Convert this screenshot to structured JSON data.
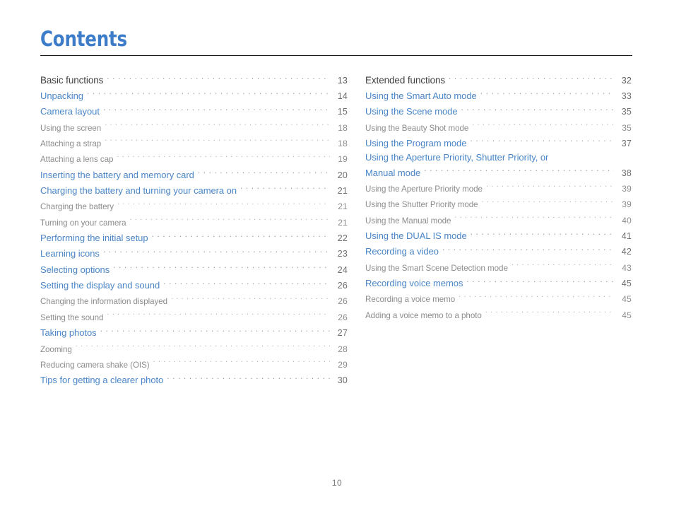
{
  "document": {
    "title": "Contents",
    "folio": "10",
    "accent_color": "#3D7CC9",
    "link_color": "#4A86C8",
    "sub_color": "#8d8d8d",
    "head_color": "#3f3f3f",
    "rule_color": "#1a1a1a"
  },
  "columns": {
    "left": {
      "entries": [
        {
          "label": "Basic functions",
          "page": "13",
          "level": "head"
        },
        {
          "label": "Unpacking",
          "page": "14",
          "level": "link"
        },
        {
          "label": "Camera layout",
          "page": "15",
          "level": "link"
        },
        {
          "label": "Using the screen",
          "page": "18",
          "level": "sub"
        },
        {
          "label": "Attaching a strap",
          "page": "18",
          "level": "sub"
        },
        {
          "label": "Attaching a lens cap",
          "page": "19",
          "level": "sub"
        },
        {
          "label": "Inserting the battery and memory card",
          "page": "20",
          "level": "link"
        },
        {
          "label": "Charging the battery and turning your camera on",
          "page": "21",
          "level": "link"
        },
        {
          "label": "Charging the battery",
          "page": "21",
          "level": "sub"
        },
        {
          "label": "Turning on your camera",
          "page": "21",
          "level": "sub"
        },
        {
          "label": "Performing the initial setup",
          "page": "22",
          "level": "link"
        },
        {
          "label": "Learning icons",
          "page": "23",
          "level": "link"
        },
        {
          "label": "Selecting options",
          "page": "24",
          "level": "link"
        },
        {
          "label": "Setting the display and sound",
          "page": "26",
          "level": "link"
        },
        {
          "label": "Changing the information displayed",
          "page": "26",
          "level": "sub"
        },
        {
          "label": "Setting the sound",
          "page": "26",
          "level": "sub"
        },
        {
          "label": "Taking photos",
          "page": "27",
          "level": "link"
        },
        {
          "label": "Zooming",
          "page": "28",
          "level": "sub"
        },
        {
          "label": "Reducing camera shake (OIS)",
          "page": "29",
          "level": "sub"
        },
        {
          "label": "Tips for getting a clearer photo",
          "page": "30",
          "level": "link"
        }
      ]
    },
    "right": {
      "entries": [
        {
          "label": "Extended functions",
          "page": "32",
          "level": "head"
        },
        {
          "label": "Using the Smart Auto mode",
          "page": "33",
          "level": "link"
        },
        {
          "label": "Using the Scene mode",
          "page": "35",
          "level": "link"
        },
        {
          "label": "Using the Beauty Shot mode",
          "page": "35",
          "level": "sub"
        },
        {
          "label": "Using the Program mode",
          "page": "37",
          "level": "link"
        },
        {
          "label": "Using the Aperture Priority, Shutter Priority, or",
          "label2": "Manual mode",
          "page": "38",
          "level": "link",
          "wrapped": true
        },
        {
          "label": "Using the Aperture Priority mode",
          "page": "39",
          "level": "sub"
        },
        {
          "label": "Using the Shutter Priority mode",
          "page": "39",
          "level": "sub"
        },
        {
          "label": "Using the Manual mode",
          "page": "40",
          "level": "sub"
        },
        {
          "label": "Using the DUAL IS mode",
          "page": "41",
          "level": "link"
        },
        {
          "label": "Recording a video",
          "page": "42",
          "level": "link"
        },
        {
          "label": "Using the Smart Scene Detection mode",
          "page": "43",
          "level": "sub"
        },
        {
          "label": "Recording voice memos",
          "page": "45",
          "level": "link"
        },
        {
          "label": "Recording a voice memo",
          "page": "45",
          "level": "sub"
        },
        {
          "label": "Adding a voice memo to a photo",
          "page": "45",
          "level": "sub"
        }
      ]
    }
  }
}
